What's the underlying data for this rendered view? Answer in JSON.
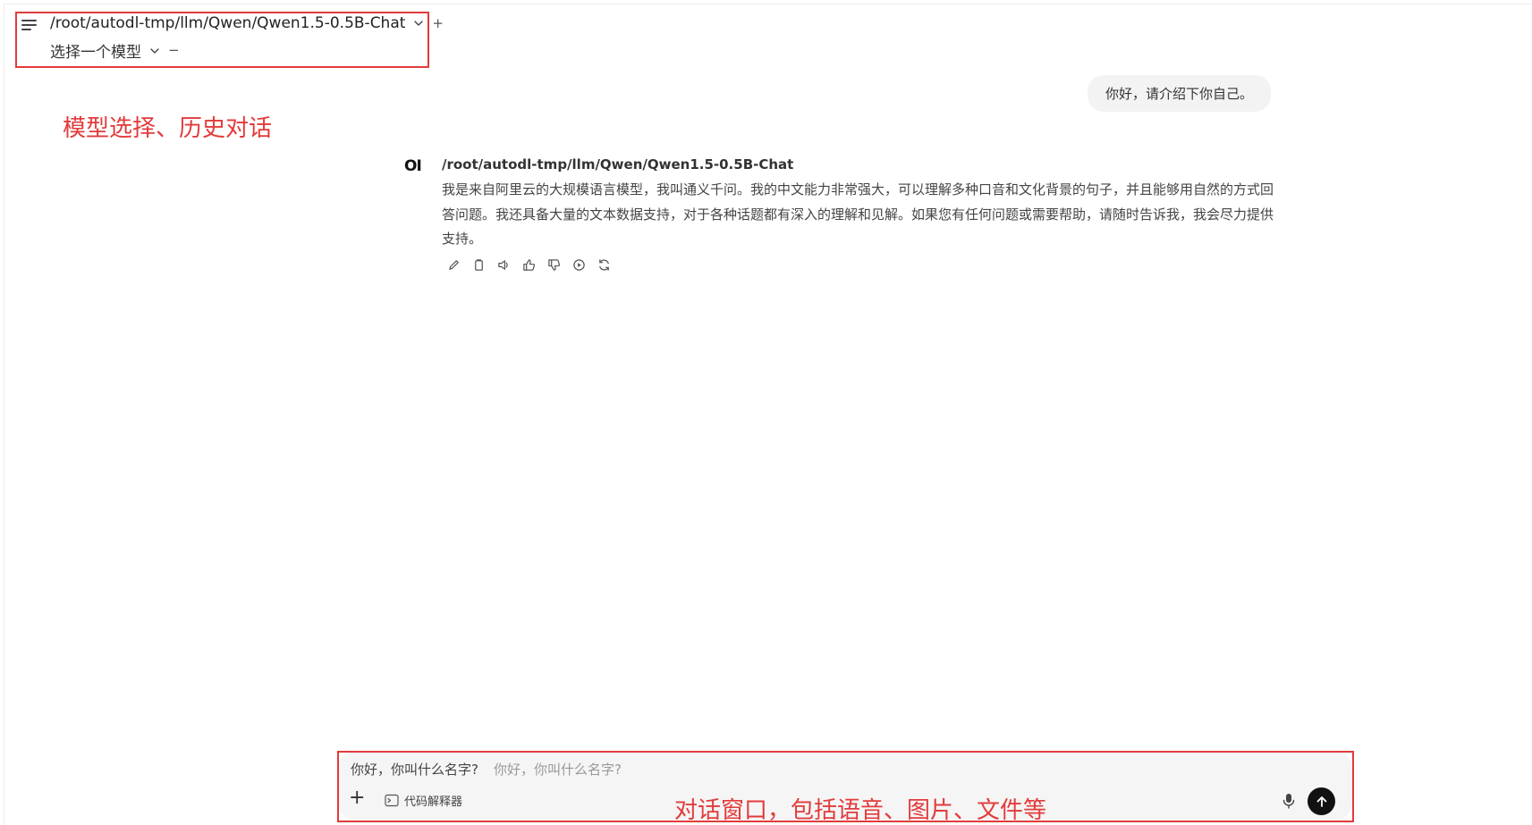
{
  "header": {
    "model_path": "/root/autodl-tmp/llm/Qwen/Qwen1.5-0.5B-Chat",
    "add_label": "+",
    "select_model_label": "选择一个模型",
    "remove_label": "−"
  },
  "annotations": {
    "top_label": "模型选择、历史对话",
    "bottom_label": "对话窗口，包括语音、图片、文件等",
    "color": "#e23b3b"
  },
  "chat": {
    "user_message": "你好，请介绍下你自己。",
    "assistant": {
      "avatar": "OI",
      "name": "/root/autodl-tmp/llm/Qwen/Qwen1.5-0.5B-Chat",
      "text": "我是来自阿里云的大规模语言模型，我叫通义千问。我的中文能力非常强大，可以理解多种口音和文化背景的句子，并且能够用自然的方式回答问题。我还具备大量的文本数据支持，对于各种话题都有深入的理解和见解。如果您有任何问题或需要帮助，请随时告诉我，我会尽力提供支持。",
      "actions": [
        "edit-icon",
        "copy-icon",
        "speaker-icon",
        "thumbs-up-icon",
        "thumbs-down-icon",
        "play-icon",
        "regenerate-icon"
      ]
    }
  },
  "input": {
    "value": "你好，你叫什么名字?",
    "placeholder": "你好，你叫什么名字?",
    "plus_label": "+",
    "tool_label": "代码解释器"
  }
}
